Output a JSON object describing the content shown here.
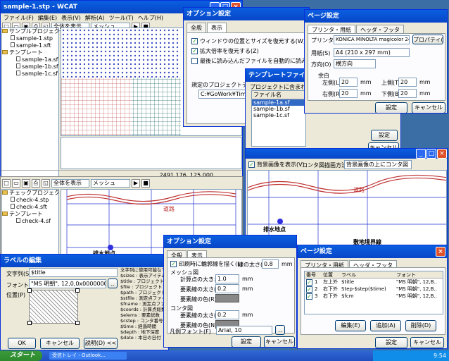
{
  "main": {
    "title": "sample-1.stp - WCAT",
    "menu": [
      "ファイル(F)",
      "編集(E)",
      "表示(V)",
      "解析(A)",
      "ツール(T)",
      "ヘルプ(H)"
    ],
    "view_select": "全体を表示",
    "mesh_select": "メッシュ",
    "tree": [
      "サンプルプロジェクト1",
      "sample-1.stp",
      "sample-1.sft",
      "テンプレート",
      "sample-1a.sf",
      "sample-1b.sf",
      "sample-1c.sf"
    ],
    "coords": "2491.176, 125.000"
  },
  "check": {
    "view_select": "全体を表示",
    "mesh_select": "メッシュ",
    "tree": [
      "チェックプロジェクト",
      "check-4.stp",
      "check-4.sft",
      "テンプレート",
      "check-4.sf"
    ],
    "label_road": "道路",
    "label_drain": "排水地点"
  },
  "option1": {
    "title": "オプション設定",
    "tabs": [
      "全般",
      "表示"
    ],
    "checks": [
      "ウィンドウの位置とサイズを復元する(W)",
      "拡大倍率を復元する(Z)",
      "最後に読み込んだファイルを自動的に読み込む(F)"
    ],
    "dir_label": "規定のプロジェクトディレクトリ(",
    "dir_value": "C:¥GoWork¥TimeWork¥TE"
  },
  "template": {
    "title": "テンプレートファイル編集",
    "label": "プロジェクトに含まれるテンプレ",
    "header": "ファイル名",
    "files": [
      "sample-1a.sf",
      "sample-1b.sf",
      "sample-1c.sf"
    ],
    "btn_ok": "設定",
    "btn_cancel": "キャンセル"
  },
  "page1": {
    "title": "ページ設定",
    "tabs": [
      "プリンタ・用紙",
      "ヘッダ・フッタ"
    ],
    "printer_label": "プリンタ(P)",
    "printer_value": "KONICA MINOLTA magicolor 2490MF",
    "props": "プロパティ(I)...",
    "paper_label": "用紙(S)",
    "paper_value": "A4 (210 x 297 mm)",
    "orient_label": "方向(O)",
    "orient_value": "横方向",
    "margin_title": "余白",
    "left": "左側(L)",
    "right": "右側(R)",
    "top": "上側(T)",
    "bottom": "下側(B)",
    "m_left": "20",
    "m_right": "20",
    "m_top": "20",
    "m_bottom": "20",
    "unit": "mm",
    "btn_ok": "設定",
    "btn_cancel": "キャンセル"
  },
  "bgdlg": {
    "check": "背景画像を表示(V)",
    "label": "コンタ図描画方法(M)",
    "value": "背景画像の上にコンタ図",
    "road": "道路",
    "drain": "排水地点",
    "boundary": "敷地境界線"
  },
  "option2": {
    "title": "オプション設定",
    "tabs": [
      "全般",
      "表示"
    ],
    "check": "印刷時に輪郭線を描く(L)",
    "line_w": "線の太さ(T)",
    "line_w_val": "0.8",
    "mm": "mm",
    "mesh_group": "メッシュ図",
    "calc_pt": "計算点の大きさ(C)",
    "calc_val": "1.0",
    "mesh_w": "要素線の太さ(E)",
    "mesh_w_val": "0.2",
    "mesh_color": "要素線の色(R)",
    "cont_group": "コンタ図",
    "cont_w": "要素線の太さ(L)",
    "cont_w_val": "0.2",
    "cont_color": "要素線の色(N)",
    "font_label": "凡例フォント(F)",
    "font_val": "Arial, 10",
    "btn_ok": "設定",
    "btn_cancel": "キャンセル"
  },
  "label": {
    "title": "ラベルの編集",
    "text_label": "文字列(S)",
    "text_val": "$title",
    "font_label": "フォント(F)",
    "font_val": "\"MS 明朝\", 12,0,0x00000000",
    "pos_label": "位置(P)",
    "btn_ok": "OK",
    "btn_cancel": "キャンセル",
    "btn_desc": "説明(D) <<",
    "vars_title": "文字列に使用可能なマ",
    "vars": [
      "$sizes : 表示アイテム",
      "$title : プロジェクト名",
      "$file : プロジェクトフ",
      "$path : プロジェクトフ",
      "$stfile : 測定点ファイル",
      "$fname : 測定点ファイル",
      "$coords : 計算点総数",
      "$elems : 要素総数",
      "$cstep : コンタ番号",
      "$time : 経過時間",
      "$depth : 地下深度",
      "$date : 本日の日付"
    ]
  },
  "page2": {
    "title": "ページ設定",
    "tabs": [
      "プリンタ・用紙",
      "ヘッダ・フッタ"
    ],
    "headers": [
      "番号",
      "位置",
      "ラベル",
      "フォント"
    ],
    "rows": [
      [
        "1",
        "左上外",
        "$title",
        "\"MS 明朝\", 12,B.."
      ],
      [
        "2",
        "右下外",
        "Step-$step($time)",
        "\"MS 明朝\", 12,B.."
      ],
      [
        "3",
        "右下外",
        "$fcm",
        "\"MS 明朝\", 12,B.."
      ]
    ],
    "btn_edit": "編集(E)",
    "btn_add": "追加(A)",
    "btn_del": "削除(D)",
    "btn_ok": "設定",
    "btn_cancel": "キャンセル"
  },
  "taskbar": {
    "start": "スタート",
    "item": "受信トレイ - Outlook...",
    "time": "9:54"
  },
  "colors": {
    "title": "#0846c8",
    "desktop": "#3a6ea5",
    "road": "#c03030",
    "grid": "#2030d0"
  }
}
